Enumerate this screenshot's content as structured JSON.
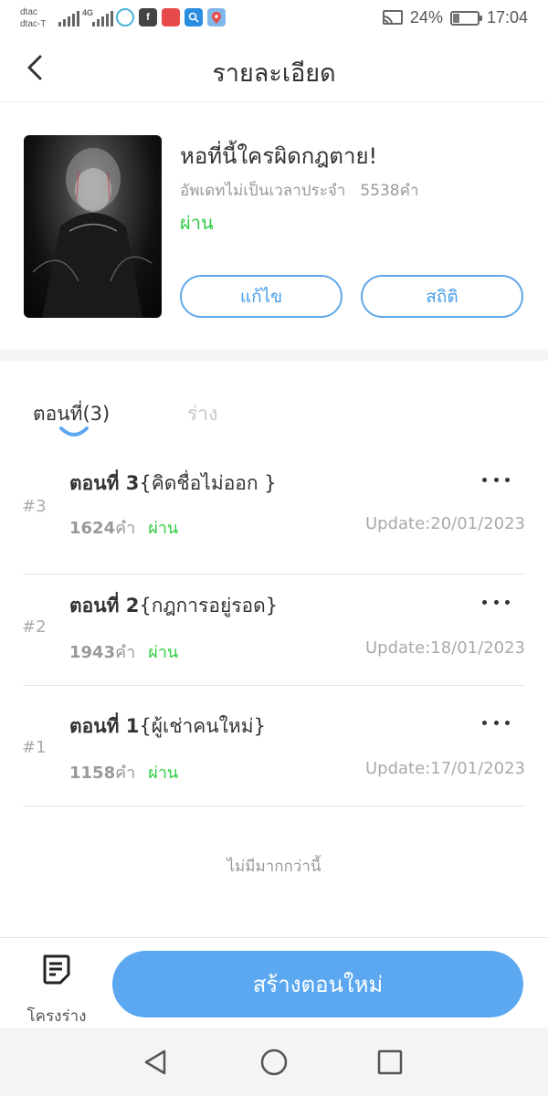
{
  "status_bar": {
    "carrier_1": "dtac",
    "carrier_2": "dtac-T",
    "network": "4G",
    "battery": "24%",
    "battery_level": 0.24,
    "time": "17:04"
  },
  "header": {
    "title": "รายละเอียด"
  },
  "book": {
    "title": "หอที่นี้ใครผิดกฎตาย!",
    "schedule": "อัพเดทไม่เป็นเวลาประจำ",
    "word_count": "5538คำ",
    "status": "ผ่าน",
    "edit_label": "แก้ไข",
    "stats_label": "สถิติ"
  },
  "tabs": {
    "episodes": "ตอนที่(3)",
    "drafts": "ร่าง"
  },
  "chapters": [
    {
      "index": "#3",
      "prefix": "ตอนที่ 3",
      "name": "{คิดชื่อไม่ออก }",
      "words": "1624",
      "words_unit": "คำ",
      "status": "ผ่าน",
      "update": "Update:20/01/2023"
    },
    {
      "index": "#2",
      "prefix": "ตอนที่ 2",
      "name": "{กฎการอยู่รอด}",
      "words": "1943",
      "words_unit": "คำ",
      "status": "ผ่าน",
      "update": "Update:18/01/2023"
    },
    {
      "index": "#1",
      "prefix": "ตอนที่ 1",
      "name": "{ผู้เช่าคนใหม่}",
      "words": "1158",
      "words_unit": "คำ",
      "status": "ผ่าน",
      "update": "Update:17/01/2023"
    }
  ],
  "list_end": "ไม่มีมากกว่านี้",
  "bottom": {
    "draft_label": "โครงร่าง",
    "create_label": "สร้างตอนใหม่"
  },
  "colors": {
    "accent": "#5ba8f0",
    "status_green": "#2ecc40"
  }
}
